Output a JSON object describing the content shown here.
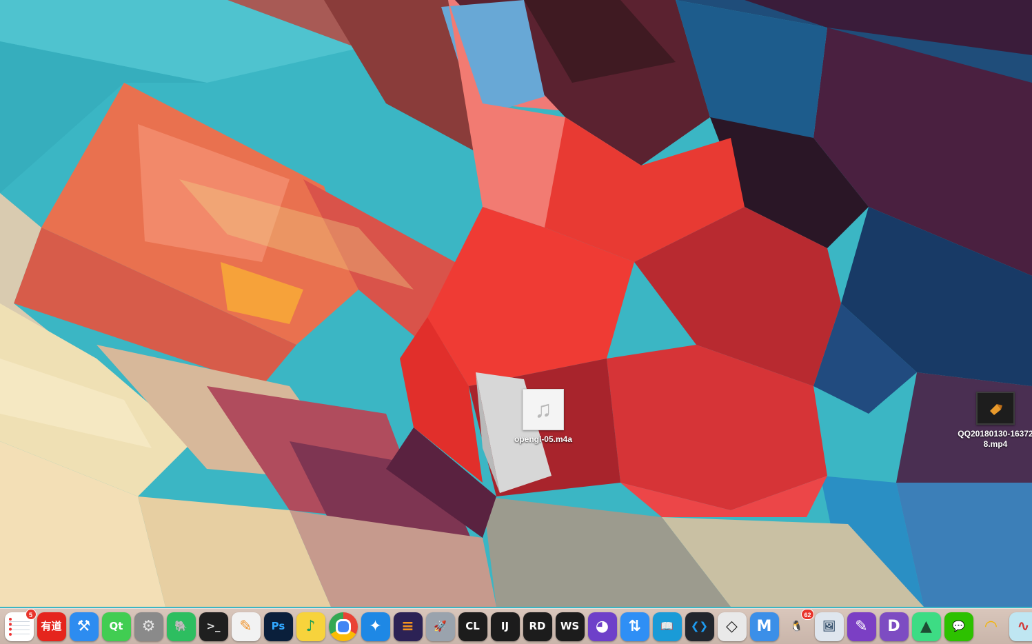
{
  "desktop": {
    "files": [
      {
        "name": "opengl-05.m4a",
        "kind": "audio",
        "icon": "music-note-icon"
      },
      {
        "name": "QQ20180130-163728.mp4",
        "kind": "video",
        "icon": "video-file-icon"
      }
    ]
  },
  "dock": {
    "items": [
      {
        "id": "reminders",
        "icon": "reminders-icon",
        "glyph": "",
        "badge": "5",
        "bg": "#ffffff",
        "fg": "#e33"
      },
      {
        "id": "youdao",
        "icon": "youdao-dictionary-icon",
        "glyph": "有道",
        "bg": "#e5251d",
        "fg": "#ffffff"
      },
      {
        "id": "xcode",
        "icon": "xcode-icon",
        "glyph": "⚒",
        "bg": "#2d8cf0",
        "fg": "#ffffff"
      },
      {
        "id": "qt",
        "icon": "qt-creator-icon",
        "glyph": "Qt",
        "bg": "#41cd52",
        "fg": "#ffffff"
      },
      {
        "id": "system-preferences",
        "icon": "system-preferences-icon",
        "glyph": "⚙",
        "bg": "#8a8a8a",
        "fg": "#e6e6e6"
      },
      {
        "id": "evernote",
        "icon": "evernote-icon",
        "glyph": "🐘",
        "bg": "#2dbe60",
        "fg": "#1e3a22"
      },
      {
        "id": "terminal",
        "icon": "terminal-icon",
        "glyph": ">_",
        "bg": "#1f1f1f",
        "fg": "#e8e8e8"
      },
      {
        "id": "pages",
        "icon": "pages-icon",
        "glyph": "✎",
        "bg": "#f2f2f2",
        "fg": "#f0932b"
      },
      {
        "id": "photoshop",
        "icon": "photoshop-icon",
        "glyph": "Ps",
        "bg": "#0a1f3b",
        "fg": "#31a8ff"
      },
      {
        "id": "qq-music",
        "icon": "qq-music-icon",
        "glyph": "♪",
        "bg": "#f7d33c",
        "fg": "#1f9d55"
      },
      {
        "id": "chrome",
        "icon": "chrome-icon",
        "glyph": "",
        "bg": "#ffffff",
        "fg": "#4285f4"
      },
      {
        "id": "safari",
        "icon": "safari-icon",
        "glyph": "✦",
        "bg": "#1e88e5",
        "fg": "#ffffff"
      },
      {
        "id": "eclipse",
        "icon": "eclipse-icon",
        "glyph": "≡",
        "bg": "#2c2255",
        "fg": "#f7941e"
      },
      {
        "id": "launchpad",
        "icon": "launchpad-icon",
        "glyph": "🚀",
        "bg": "#9aa3ad",
        "fg": "#2d3640"
      },
      {
        "id": "clion",
        "icon": "clion-icon",
        "glyph": "CL",
        "bg": "#1c1c1c",
        "fg": "#ffffff"
      },
      {
        "id": "intellij",
        "icon": "intellij-idea-icon",
        "glyph": "IJ",
        "bg": "#1c1c1c",
        "fg": "#ffffff"
      },
      {
        "id": "rider",
        "icon": "rider-icon",
        "glyph": "RD",
        "bg": "#1c1c1c",
        "fg": "#ffffff"
      },
      {
        "id": "webstorm",
        "icon": "webstorm-icon",
        "glyph": "WS",
        "bg": "#1c1c1c",
        "fg": "#ffffff"
      },
      {
        "id": "github",
        "icon": "github-desktop-icon",
        "glyph": "◕",
        "bg": "#6e40c9",
        "fg": "#ffffff"
      },
      {
        "id": "transmit",
        "icon": "upload-download-icon",
        "glyph": "⇅",
        "bg": "#2f8ff5",
        "fg": "#ffffff"
      },
      {
        "id": "kindle",
        "icon": "kindle-icon",
        "glyph": "📖",
        "bg": "#1a9bd7",
        "fg": "#0b1a24"
      },
      {
        "id": "vscode",
        "icon": "visual-studio-code-icon",
        "glyph": "❮❯",
        "bg": "#22262d",
        "fg": "#1d9bf0"
      },
      {
        "id": "unity",
        "icon": "unity-icon",
        "glyph": "◇",
        "bg": "#e9e9e9",
        "fg": "#222222"
      },
      {
        "id": "markdown",
        "icon": "markdown-editor-icon",
        "glyph": "M",
        "bg": "#3b8fe8",
        "fg": "#ffffff"
      },
      {
        "id": "qq",
        "icon": "qq-penguin-icon",
        "glyph": "🐧",
        "badge": "62",
        "bg": "transparent",
        "fg": "#111111"
      },
      {
        "id": "preview",
        "icon": "preview-photos-icon",
        "glyph": "🖼",
        "bg": "#dfe6ee",
        "fg": "#35506b"
      },
      {
        "id": "pencil",
        "icon": "pencil-app-icon",
        "glyph": "✎",
        "bg": "#7b3fc4",
        "fg": "#ffffff"
      },
      {
        "id": "dash",
        "icon": "dash-docs-icon",
        "glyph": "D",
        "bg": "#7d4cc2",
        "fg": "#ffffff"
      },
      {
        "id": "android-studio",
        "icon": "android-studio-icon",
        "glyph": "▲",
        "bg": "#3ddc84",
        "fg": "#1d4d33"
      },
      {
        "id": "wechat",
        "icon": "wechat-icon",
        "glyph": "💬",
        "bg": "#2dc100",
        "fg": "#ffffff"
      },
      {
        "id": "wifi",
        "icon": "wifi-signal-icon",
        "glyph": "◠",
        "bg": "transparent",
        "fg": "#f5b400"
      },
      {
        "id": "audio-wave",
        "icon": "audio-waveform-icon",
        "glyph": "∿",
        "bg": "#bfe6f2",
        "fg": "#d23a3a"
      }
    ]
  }
}
